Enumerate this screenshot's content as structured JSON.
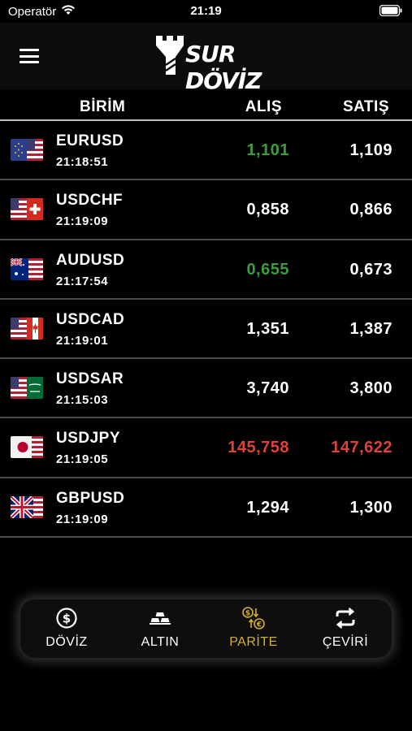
{
  "status_bar": {
    "carrier": "Operatör",
    "time": "21:19"
  },
  "header": {
    "logo_text": "SUR DÖVİZ"
  },
  "columns": {
    "unit": "BİRİM",
    "buy": "ALIŞ",
    "sell": "SATIŞ"
  },
  "rows": [
    {
      "pair": "EURUSD",
      "time": "21:18:51",
      "buy": "1,101",
      "sell": "1,109",
      "buy_trend": "up",
      "sell_trend": "flat",
      "flag": "eu"
    },
    {
      "pair": "USDCHF",
      "time": "21:19:09",
      "buy": "0,858",
      "sell": "0,866",
      "buy_trend": "flat",
      "sell_trend": "flat",
      "flag": "ch"
    },
    {
      "pair": "AUDUSD",
      "time": "21:17:54",
      "buy": "0,655",
      "sell": "0,673",
      "buy_trend": "up",
      "sell_trend": "flat",
      "flag": "au"
    },
    {
      "pair": "USDCAD",
      "time": "21:19:01",
      "buy": "1,351",
      "sell": "1,387",
      "buy_trend": "flat",
      "sell_trend": "flat",
      "flag": "ca"
    },
    {
      "pair": "USDSAR",
      "time": "21:15:03",
      "buy": "3,740",
      "sell": "3,800",
      "buy_trend": "flat",
      "sell_trend": "flat",
      "flag": "sa"
    },
    {
      "pair": "USDJPY",
      "time": "21:19:05",
      "buy": "145,758",
      "sell": "147,622",
      "buy_trend": "down",
      "sell_trend": "down",
      "flag": "jp"
    },
    {
      "pair": "GBPUSD",
      "time": "21:19:09",
      "buy": "1,294",
      "sell": "1,300",
      "buy_trend": "flat",
      "sell_trend": "flat",
      "flag": "gb"
    }
  ],
  "nav": [
    {
      "label": "DÖVİZ",
      "icon": "dollar-coin-icon",
      "active": false
    },
    {
      "label": "ALTIN",
      "icon": "gold-bars-icon",
      "active": false
    },
    {
      "label": "PARİTE",
      "icon": "currency-exchange-icon",
      "active": true
    },
    {
      "label": "ÇEVİRİ",
      "icon": "swap-arrows-icon",
      "active": false
    }
  ],
  "colors": {
    "up": "#3f9a3f",
    "down": "#e0413a",
    "active_nav": "#d4b12d",
    "background": "#000000"
  }
}
